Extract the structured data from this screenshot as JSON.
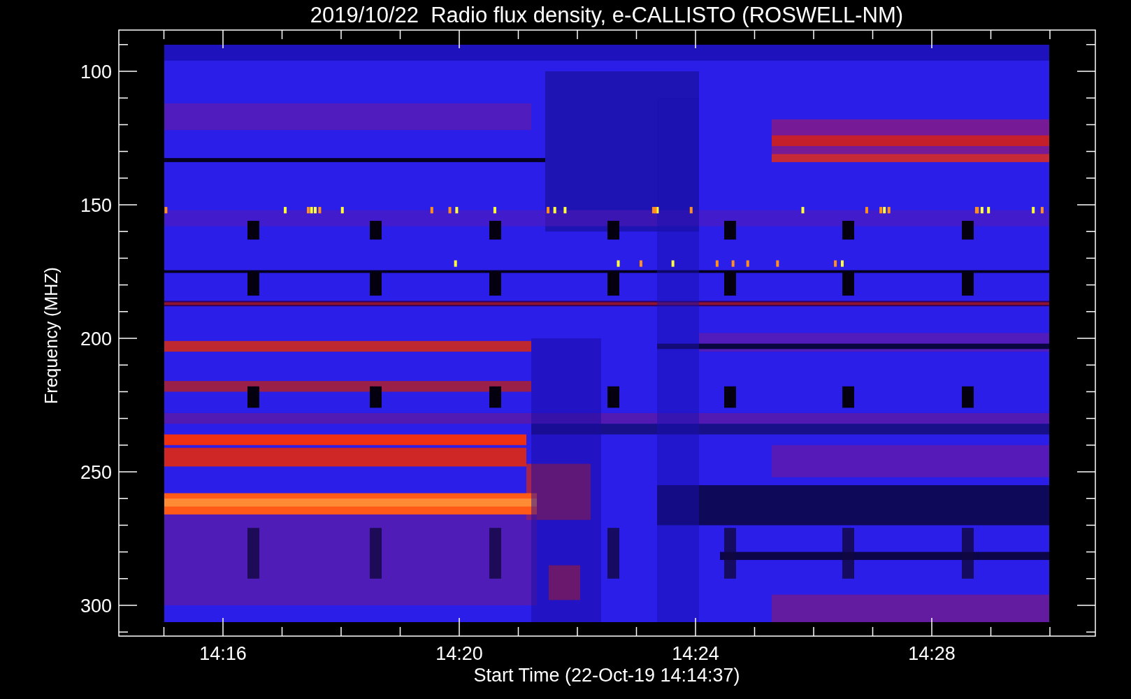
{
  "title": "2019/10/22  Radio flux density, e-CALLISTO (ROSWELL-NM)",
  "y_axis": {
    "label": "Frequency (MHZ)",
    "ticks": [
      "100",
      "150",
      "200",
      "250",
      "300"
    ]
  },
  "x_axis": {
    "label": "Start Time (22-Oct-19 14:14:37)",
    "ticks": [
      "14:16",
      "14:20",
      "14:24",
      "14:28"
    ]
  }
}
